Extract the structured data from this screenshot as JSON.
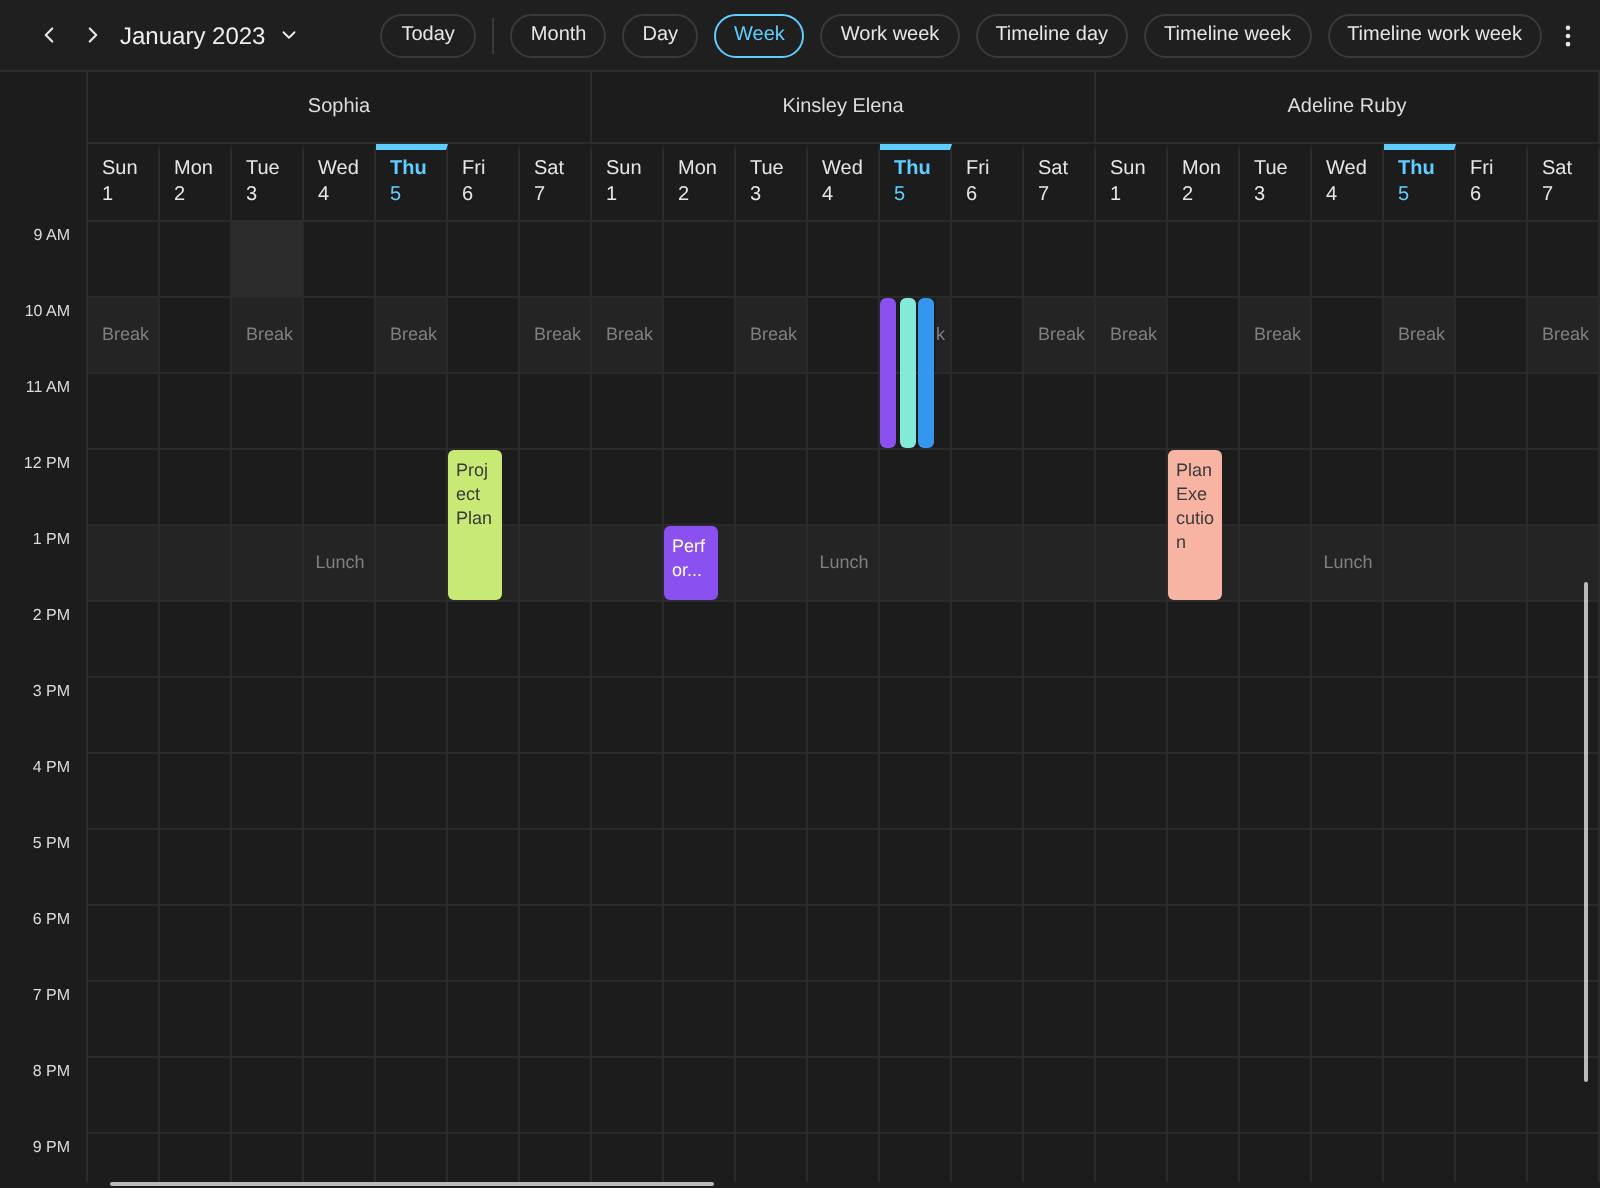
{
  "toolbar": {
    "month": "January 2023",
    "today_button": "Today",
    "views": [
      {
        "label": "Month",
        "selected": false
      },
      {
        "label": "Day",
        "selected": false
      },
      {
        "label": "Week",
        "selected": true
      },
      {
        "label": "Work week",
        "selected": false
      },
      {
        "label": "Timeline day",
        "selected": false
      },
      {
        "label": "Timeline week",
        "selected": false
      },
      {
        "label": "Timeline work week",
        "selected": false
      }
    ]
  },
  "hours": [
    {
      "label": "9 AM"
    },
    {
      "label": "10 AM",
      "kind": "break"
    },
    {
      "label": "11 AM"
    },
    {
      "label": "12 PM"
    },
    {
      "label": "1 PM",
      "kind": "lunch"
    },
    {
      "label": "2 PM"
    },
    {
      "label": "3 PM"
    },
    {
      "label": "4 PM"
    },
    {
      "label": "5 PM"
    },
    {
      "label": "6 PM"
    },
    {
      "label": "7 PM"
    },
    {
      "label": "8 PM"
    },
    {
      "label": "9 PM"
    }
  ],
  "resources": [
    {
      "name": "Sophia",
      "days": [
        {
          "day": "Sun",
          "date": "1",
          "today": false,
          "slot_selected": false,
          "break": "Break"
        },
        {
          "day": "Mon",
          "date": "2",
          "today": false,
          "slot_selected": false
        },
        {
          "day": "Tue",
          "date": "3",
          "today": false,
          "slot_selected": true,
          "break": "Break"
        },
        {
          "day": "Wed",
          "date": "4",
          "today": false,
          "slot_selected": false,
          "lunch": "Lunch"
        },
        {
          "day": "Thu",
          "date": "5",
          "today": true,
          "slot_selected": false,
          "break": "Break"
        },
        {
          "day": "Fri",
          "date": "6",
          "today": false,
          "slot_selected": false,
          "events": [
            {
              "title": "Project Plan",
              "color": "#c8ea74"
            }
          ]
        },
        {
          "day": "Sat",
          "date": "7",
          "today": false,
          "slot_selected": false,
          "break": "Break"
        }
      ]
    },
    {
      "name": "Kinsley Elena",
      "days": [
        {
          "day": "Sun",
          "date": "1",
          "today": false,
          "slot_selected": false,
          "break": "Break"
        },
        {
          "day": "Mon",
          "date": "2",
          "today": false,
          "slot_selected": false,
          "events": [
            {
              "title": "Perfor...",
              "color": "#8b50f0"
            }
          ]
        },
        {
          "day": "Tue",
          "date": "3",
          "today": false,
          "slot_selected": false,
          "break": "Break"
        },
        {
          "day": "Wed",
          "date": "4",
          "today": false,
          "slot_selected": false,
          "lunch": "Lunch"
        },
        {
          "day": "Thu",
          "date": "5",
          "today": true,
          "slot_selected": false,
          "break": "k",
          "events": [
            {
              "color": "#8b50f0"
            },
            {
              "color": "#84ead8"
            },
            {
              "color": "#3596ee"
            }
          ]
        },
        {
          "day": "Fri",
          "date": "6",
          "today": false,
          "slot_selected": false
        },
        {
          "day": "Sat",
          "date": "7",
          "today": false,
          "slot_selected": false,
          "break": "Break"
        }
      ]
    },
    {
      "name": "Adeline Ruby",
      "days": [
        {
          "day": "Sun",
          "date": "1",
          "today": false,
          "slot_selected": false,
          "break": "Break"
        },
        {
          "day": "Mon",
          "date": "2",
          "today": false,
          "slot_selected": false,
          "events": [
            {
              "title": "Plan Execution",
              "color": "#f8b4a2"
            }
          ]
        },
        {
          "day": "Tue",
          "date": "3",
          "today": false,
          "slot_selected": false,
          "break": "Break"
        },
        {
          "day": "Wed",
          "date": "4",
          "today": false,
          "slot_selected": false,
          "lunch": "Lunch"
        },
        {
          "day": "Thu",
          "date": "5",
          "today": true,
          "slot_selected": false,
          "break": "Break"
        },
        {
          "day": "Fri",
          "date": "6",
          "today": false,
          "slot_selected": false
        },
        {
          "day": "Sat",
          "date": "7",
          "today": false,
          "slot_selected": false,
          "break": "Break"
        }
      ]
    }
  ]
}
